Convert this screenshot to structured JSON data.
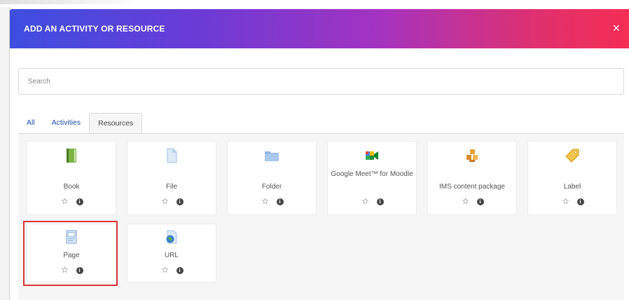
{
  "dialog": {
    "title": "ADD AN ACTIVITY OR RESOURCE",
    "close_label": "×"
  },
  "search": {
    "placeholder": "Search"
  },
  "tabs": [
    {
      "label": "All"
    },
    {
      "label": "Activities"
    },
    {
      "label": "Resources",
      "active": true
    }
  ],
  "resources": [
    {
      "name": "Book",
      "icon": "book-icon"
    },
    {
      "name": "File",
      "icon": "file-icon"
    },
    {
      "name": "Folder",
      "icon": "folder-icon"
    },
    {
      "name": "Google Meet™ for Moodle",
      "icon": "google-meet-icon"
    },
    {
      "name": "IMS content package",
      "icon": "ims-package-icon"
    },
    {
      "name": "Label",
      "icon": "label-tag-icon"
    },
    {
      "name": "Page",
      "icon": "page-icon",
      "highlighted": true
    },
    {
      "name": "URL",
      "icon": "url-globe-icon"
    }
  ],
  "icons": {
    "star": "☆",
    "info": "i"
  },
  "colors": {
    "header_gradient_start": "#3d4ee0",
    "header_gradient_end": "#f52e55",
    "tab_link": "#1f4ba8",
    "highlight_border": "#d9343a"
  }
}
